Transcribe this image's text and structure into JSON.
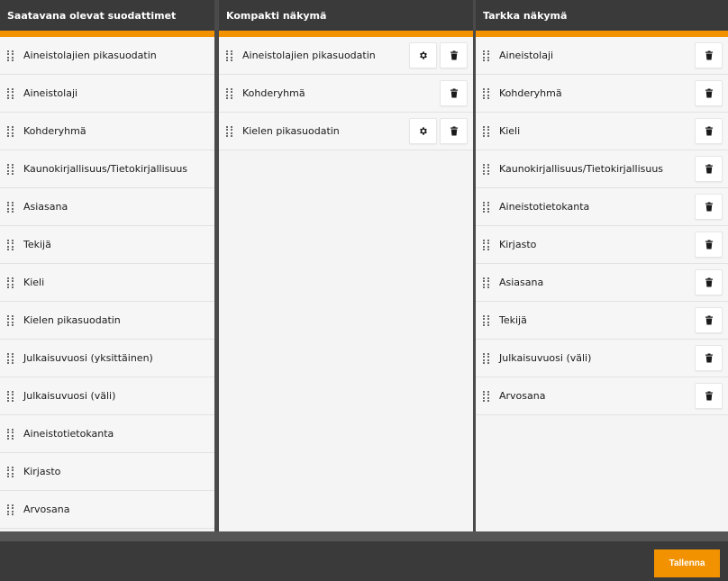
{
  "columns": {
    "available": {
      "title": "Saatavana olevat suodattimet",
      "items": [
        "Aineistolajien pikasuodatin",
        "Aineistolaji",
        "Kohderyhmä",
        "Kaunokirjallisuus/Tietokirjallisuus",
        "Asiasana",
        "Tekijä",
        "Kieli",
        "Kielen pikasuodatin",
        "Julkaisuvuosi (yksittäinen)",
        "Julkaisuvuosi (väli)",
        "Aineistotietokanta",
        "Kirjasto",
        "Arvosana"
      ]
    },
    "compact": {
      "title": "Kompakti näkymä",
      "items": [
        {
          "label": "Aineistolajien pikasuodatin",
          "settings": true
        },
        {
          "label": "Kohderyhmä",
          "settings": false
        },
        {
          "label": "Kielen pikasuodatin",
          "settings": true
        }
      ]
    },
    "detailed": {
      "title": "Tarkka näkymä",
      "items": [
        "Aineistolaji",
        "Kohderyhmä",
        "Kieli",
        "Kaunokirjallisuus/Tietokirjallisuus",
        "Aineistotietokanta",
        "Kirjasto",
        "Asiasana",
        "Tekijä",
        "Julkaisuvuosi (väli)",
        "Arvosana"
      ]
    }
  },
  "footer": {
    "save_label": "Tallenna"
  },
  "icons": {
    "drag": "drag-handle-icon",
    "settings": "gear-icon",
    "delete": "trash-icon"
  },
  "colors": {
    "accent": "#f39200",
    "header_bg": "#3a3a3a",
    "panel_bg": "#f4f4f4"
  }
}
